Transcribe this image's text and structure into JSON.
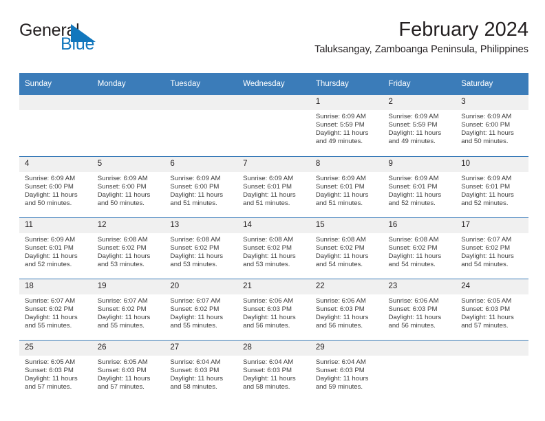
{
  "brand": {
    "name_part1": "General",
    "name_part2": "Blue",
    "triangle_color": "#1277bd",
    "text_color": "#231f20"
  },
  "header": {
    "title": "February 2024",
    "subtitle": "Taluksangay, Zamboanga Peninsula, Philippines"
  },
  "theme": {
    "header_bg": "#3b7cb9",
    "header_text": "#ffffff",
    "daynum_bg": "#f0f0f0",
    "grid_line": "#3b7cb9",
    "body_text": "#3b3b3b"
  },
  "weekday_headers": [
    "Sunday",
    "Monday",
    "Tuesday",
    "Wednesday",
    "Thursday",
    "Friday",
    "Saturday"
  ],
  "weeks": [
    [
      {
        "day": "",
        "lines": []
      },
      {
        "day": "",
        "lines": []
      },
      {
        "day": "",
        "lines": []
      },
      {
        "day": "",
        "lines": []
      },
      {
        "day": "1",
        "lines": [
          "Sunrise: 6:09 AM",
          "Sunset: 5:59 PM",
          "Daylight: 11 hours",
          "and 49 minutes."
        ]
      },
      {
        "day": "2",
        "lines": [
          "Sunrise: 6:09 AM",
          "Sunset: 5:59 PM",
          "Daylight: 11 hours",
          "and 49 minutes."
        ]
      },
      {
        "day": "3",
        "lines": [
          "Sunrise: 6:09 AM",
          "Sunset: 6:00 PM",
          "Daylight: 11 hours",
          "and 50 minutes."
        ]
      }
    ],
    [
      {
        "day": "4",
        "lines": [
          "Sunrise: 6:09 AM",
          "Sunset: 6:00 PM",
          "Daylight: 11 hours",
          "and 50 minutes."
        ]
      },
      {
        "day": "5",
        "lines": [
          "Sunrise: 6:09 AM",
          "Sunset: 6:00 PM",
          "Daylight: 11 hours",
          "and 50 minutes."
        ]
      },
      {
        "day": "6",
        "lines": [
          "Sunrise: 6:09 AM",
          "Sunset: 6:00 PM",
          "Daylight: 11 hours",
          "and 51 minutes."
        ]
      },
      {
        "day": "7",
        "lines": [
          "Sunrise: 6:09 AM",
          "Sunset: 6:01 PM",
          "Daylight: 11 hours",
          "and 51 minutes."
        ]
      },
      {
        "day": "8",
        "lines": [
          "Sunrise: 6:09 AM",
          "Sunset: 6:01 PM",
          "Daylight: 11 hours",
          "and 51 minutes."
        ]
      },
      {
        "day": "9",
        "lines": [
          "Sunrise: 6:09 AM",
          "Sunset: 6:01 PM",
          "Daylight: 11 hours",
          "and 52 minutes."
        ]
      },
      {
        "day": "10",
        "lines": [
          "Sunrise: 6:09 AM",
          "Sunset: 6:01 PM",
          "Daylight: 11 hours",
          "and 52 minutes."
        ]
      }
    ],
    [
      {
        "day": "11",
        "lines": [
          "Sunrise: 6:09 AM",
          "Sunset: 6:01 PM",
          "Daylight: 11 hours",
          "and 52 minutes."
        ]
      },
      {
        "day": "12",
        "lines": [
          "Sunrise: 6:08 AM",
          "Sunset: 6:02 PM",
          "Daylight: 11 hours",
          "and 53 minutes."
        ]
      },
      {
        "day": "13",
        "lines": [
          "Sunrise: 6:08 AM",
          "Sunset: 6:02 PM",
          "Daylight: 11 hours",
          "and 53 minutes."
        ]
      },
      {
        "day": "14",
        "lines": [
          "Sunrise: 6:08 AM",
          "Sunset: 6:02 PM",
          "Daylight: 11 hours",
          "and 53 minutes."
        ]
      },
      {
        "day": "15",
        "lines": [
          "Sunrise: 6:08 AM",
          "Sunset: 6:02 PM",
          "Daylight: 11 hours",
          "and 54 minutes."
        ]
      },
      {
        "day": "16",
        "lines": [
          "Sunrise: 6:08 AM",
          "Sunset: 6:02 PM",
          "Daylight: 11 hours",
          "and 54 minutes."
        ]
      },
      {
        "day": "17",
        "lines": [
          "Sunrise: 6:07 AM",
          "Sunset: 6:02 PM",
          "Daylight: 11 hours",
          "and 54 minutes."
        ]
      }
    ],
    [
      {
        "day": "18",
        "lines": [
          "Sunrise: 6:07 AM",
          "Sunset: 6:02 PM",
          "Daylight: 11 hours",
          "and 55 minutes."
        ]
      },
      {
        "day": "19",
        "lines": [
          "Sunrise: 6:07 AM",
          "Sunset: 6:02 PM",
          "Daylight: 11 hours",
          "and 55 minutes."
        ]
      },
      {
        "day": "20",
        "lines": [
          "Sunrise: 6:07 AM",
          "Sunset: 6:02 PM",
          "Daylight: 11 hours",
          "and 55 minutes."
        ]
      },
      {
        "day": "21",
        "lines": [
          "Sunrise: 6:06 AM",
          "Sunset: 6:03 PM",
          "Daylight: 11 hours",
          "and 56 minutes."
        ]
      },
      {
        "day": "22",
        "lines": [
          "Sunrise: 6:06 AM",
          "Sunset: 6:03 PM",
          "Daylight: 11 hours",
          "and 56 minutes."
        ]
      },
      {
        "day": "23",
        "lines": [
          "Sunrise: 6:06 AM",
          "Sunset: 6:03 PM",
          "Daylight: 11 hours",
          "and 56 minutes."
        ]
      },
      {
        "day": "24",
        "lines": [
          "Sunrise: 6:05 AM",
          "Sunset: 6:03 PM",
          "Daylight: 11 hours",
          "and 57 minutes."
        ]
      }
    ],
    [
      {
        "day": "25",
        "lines": [
          "Sunrise: 6:05 AM",
          "Sunset: 6:03 PM",
          "Daylight: 11 hours",
          "and 57 minutes."
        ]
      },
      {
        "day": "26",
        "lines": [
          "Sunrise: 6:05 AM",
          "Sunset: 6:03 PM",
          "Daylight: 11 hours",
          "and 57 minutes."
        ]
      },
      {
        "day": "27",
        "lines": [
          "Sunrise: 6:04 AM",
          "Sunset: 6:03 PM",
          "Daylight: 11 hours",
          "and 58 minutes."
        ]
      },
      {
        "day": "28",
        "lines": [
          "Sunrise: 6:04 AM",
          "Sunset: 6:03 PM",
          "Daylight: 11 hours",
          "and 58 minutes."
        ]
      },
      {
        "day": "29",
        "lines": [
          "Sunrise: 6:04 AM",
          "Sunset: 6:03 PM",
          "Daylight: 11 hours",
          "and 59 minutes."
        ]
      },
      {
        "day": "",
        "lines": []
      },
      {
        "day": "",
        "lines": []
      }
    ]
  ]
}
